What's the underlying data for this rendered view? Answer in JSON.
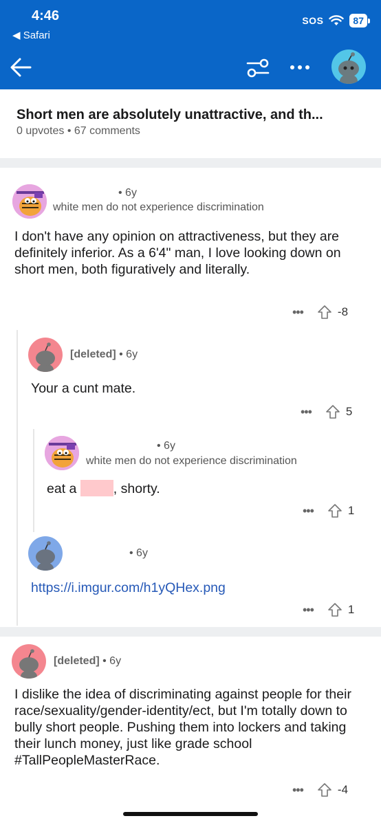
{
  "status_bar": {
    "time": "4:46",
    "back_app": "◀ Safari",
    "sos": "SOS",
    "battery": "87"
  },
  "nav": {
    "back_icon": "arrow-left-icon",
    "filter_icon": "sort-filter-icon",
    "more_icon": "more-dots-icon",
    "avatar_icon": "snoo-avatar-icon"
  },
  "post": {
    "title": "Short men are absolutely unattractive, and th...",
    "meta": "0 upvotes • 67 comments"
  },
  "comments": [
    {
      "meta": "• 6y",
      "flair": "white men do not experience discrimination",
      "body": "I don't have any opinion on attractiveness, but they are definitely inferior.  As a 6'4\" man, I love looking down on short men, both figuratively and literally.",
      "more": "•••",
      "score": "-8"
    },
    {
      "author": "[deleted]",
      "meta": "• 6y",
      "body": "Your a cunt mate.",
      "more": "•••",
      "score": "5"
    },
    {
      "meta": "• 6y",
      "flair": "white men do not experience discrimination",
      "body_before": "eat a",
      "body_after": ", shorty.",
      "more": "•••",
      "score": "1"
    },
    {
      "meta": "• 6y",
      "body": "https://i.imgur.com/h1yQHex.png",
      "more": "•••",
      "score": "1"
    },
    {
      "author": "[deleted]",
      "meta": "• 6y",
      "body": "I dislike the idea of discriminating against people for their race/sexuality/gender-identity/ect, but I'm totally down to bully short people. Pushing them into lockers and taking their lunch money, just like grade school #TallPeopleMasterRace.",
      "more": "•••",
      "score": "-4"
    }
  ],
  "colors": {
    "header": "#0a66c8",
    "link": "#2659b7",
    "avatar_blue": "#53c6e8",
    "deleted_avatar": "#f4868f"
  }
}
